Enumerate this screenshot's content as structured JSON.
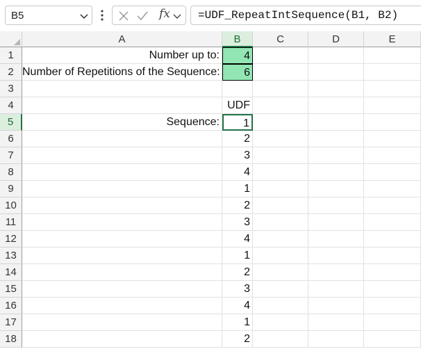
{
  "formula_bar": {
    "name_box": "B5",
    "formula": "=UDF_RepeatIntSequence(B1, B2)",
    "fx_label": "fx",
    "tools": [
      "cancel-icon",
      "enter-icon",
      "function-icon"
    ]
  },
  "columns": [
    "A",
    "B",
    "C",
    "D",
    "E"
  ],
  "active_column": "B",
  "rows": [
    "1",
    "2",
    "3",
    "4",
    "5",
    "6",
    "7",
    "8",
    "9",
    "10",
    "11",
    "12",
    "13",
    "14",
    "15",
    "16",
    "17",
    "18"
  ],
  "active_row": "5",
  "cells": {
    "A1": "Number up to:",
    "B1": "4",
    "A2": "Number of Repetitions of the Sequence:",
    "B2": "6",
    "B4": "UDF",
    "A5": "Sequence:",
    "B5": "1",
    "B6": "2",
    "B7": "3",
    "B8": "4",
    "B9": "1",
    "B10": "2",
    "B11": "3",
    "B12": "4",
    "B13": "1",
    "B14": "2",
    "B15": "3",
    "B16": "4",
    "B17": "1",
    "B18": "2"
  },
  "styles": {
    "input_fill": "#92e6b3",
    "selection": "#217346",
    "header_bg": "#f3f3f3"
  }
}
